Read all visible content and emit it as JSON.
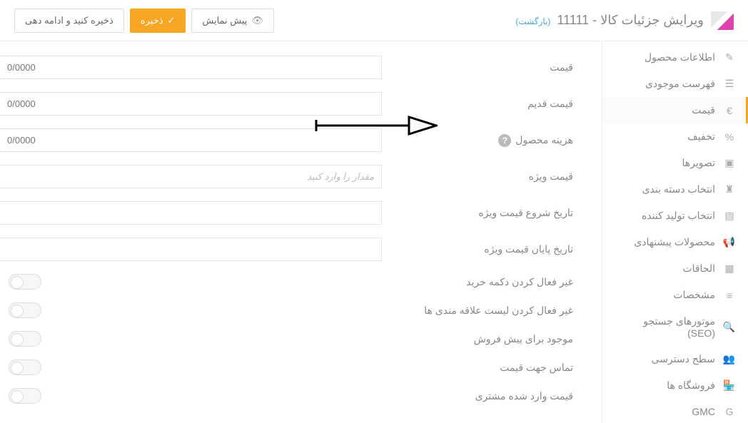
{
  "header": {
    "title_prefix": "ویرایش جزئیات کالا -",
    "title_id": "11111",
    "back_label": "(بازگشت)",
    "preview_label": "پیش نمایش",
    "save_label": "ذخیره",
    "save_continue_label": "ذخیره کنید و ادامه دهی"
  },
  "sidebar": {
    "items": [
      {
        "label": "اطلاعات محصول",
        "icon": "✎",
        "name": "product-info"
      },
      {
        "label": "فهرست موجودی",
        "icon": "☰",
        "name": "inventory"
      },
      {
        "label": "قیمت",
        "icon": "€",
        "name": "price",
        "active": true
      },
      {
        "label": "تخفیف",
        "icon": "%",
        "name": "discount"
      },
      {
        "label": "تصویرها",
        "icon": "▣",
        "name": "images"
      },
      {
        "label": "انتخاب دسته بندی",
        "icon": "♜",
        "name": "category"
      },
      {
        "label": "انتخاب تولید کننده",
        "icon": "▤",
        "name": "manufacturer"
      },
      {
        "label": "محصولات پیشنهادی",
        "icon": "📢",
        "name": "related"
      },
      {
        "label": "الحاقات",
        "icon": "▦",
        "name": "attachments"
      },
      {
        "label": "مشخصات",
        "icon": "≡",
        "name": "specs"
      },
      {
        "label": "موتورهای جستجو (SEO)",
        "icon": "🔍",
        "name": "seo"
      },
      {
        "label": "سطح دسترسی",
        "icon": "👥",
        "name": "access"
      },
      {
        "label": "فروشگاه ها",
        "icon": "🏪",
        "name": "stores"
      },
      {
        "label": "GMC",
        "icon": "G",
        "name": "gmc"
      }
    ]
  },
  "form": {
    "price_label": "قیمت",
    "price_value": "0/0000",
    "old_price_label": "قیمت قدیم",
    "old_price_value": "0/0000",
    "cost_label": "هزینه محصول",
    "cost_value": "0/0000",
    "special_price_label": "قیمت ویژه",
    "special_price_placeholder": "مقدار را وارد کنید",
    "special_start_label": "تاریخ شروع قیمت ویژه",
    "special_end_label": "تاریخ پایان قیمت ویژه",
    "disable_buy_label": "غیر فعال کردن دکمه خرید",
    "disable_wishlist_label": "غیر فعال کردن لیست علاقه مندی ها",
    "preorder_label": "موجود برای پیش فروش",
    "call_price_label": "تماس جهت قیمت",
    "customer_price_label": "قیمت وارد شده مشتری",
    "toggle_off": "off"
  }
}
